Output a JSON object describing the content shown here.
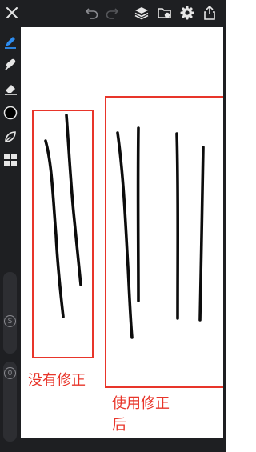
{
  "toolbar": {
    "icons": [
      "close-icon",
      "undo-icon",
      "redo-icon",
      "layers-icon",
      "gallery-icon",
      "settings-icon",
      "export-icon"
    ]
  },
  "sidebar": {
    "tools": [
      "pen-tool-icon",
      "smudge-tool-icon",
      "eraser-tool-icon",
      "color-swatch",
      "lasso-tool-icon",
      "transform-tool-icon"
    ],
    "active_color": "#000000",
    "accent": "#2d8cf0",
    "size_label": "S",
    "opacity_label": "0"
  },
  "annotations": {
    "left_label": "没有修正",
    "right_label_line1": "使用修正",
    "right_label_line2": "后"
  },
  "colors": {
    "ui_dark": "#1e1f22",
    "box_red": "#e8352a"
  }
}
